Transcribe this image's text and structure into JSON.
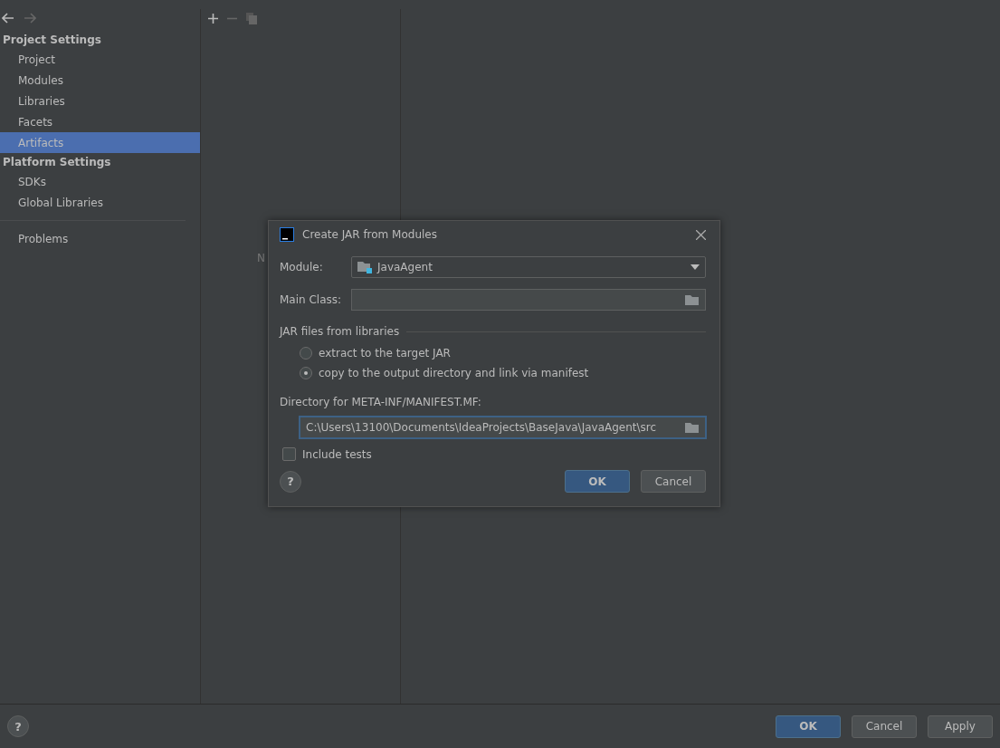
{
  "sidebar": {
    "groups": [
      {
        "title": "Project Settings",
        "items": [
          {
            "label": "Project",
            "selected": false
          },
          {
            "label": "Modules",
            "selected": false
          },
          {
            "label": "Libraries",
            "selected": false
          },
          {
            "label": "Facets",
            "selected": false
          },
          {
            "label": "Artifacts",
            "selected": true
          }
        ]
      },
      {
        "title": "Platform Settings",
        "items": [
          {
            "label": "SDKs",
            "selected": false
          },
          {
            "label": "Global Libraries",
            "selected": false
          }
        ]
      }
    ],
    "extra_items": [
      {
        "label": "Problems",
        "selected": false
      }
    ]
  },
  "middle": {
    "empty_text": "N"
  },
  "dialog": {
    "title": "Create JAR from Modules",
    "module_label": "Module:",
    "module_value": "JavaAgent",
    "main_class_label": "Main Class:",
    "libraries_title": "JAR files from libraries",
    "options": [
      {
        "label": "extract to the target JAR",
        "selected": false
      },
      {
        "label": "copy to the output directory and link via manifest",
        "selected": true
      }
    ],
    "manifest_label": "Directory for META-INF/MANIFEST.MF:",
    "manifest_value": "C:\\Users\\13100\\Documents\\IdeaProjects\\BaseJava\\JavaAgent\\src",
    "include_tests": {
      "label": "Include tests",
      "checked": false
    },
    "help": "?",
    "ok": "OK",
    "cancel": "Cancel"
  },
  "footer": {
    "help": "?",
    "ok": "OK",
    "cancel": "Cancel",
    "apply": "Apply"
  }
}
